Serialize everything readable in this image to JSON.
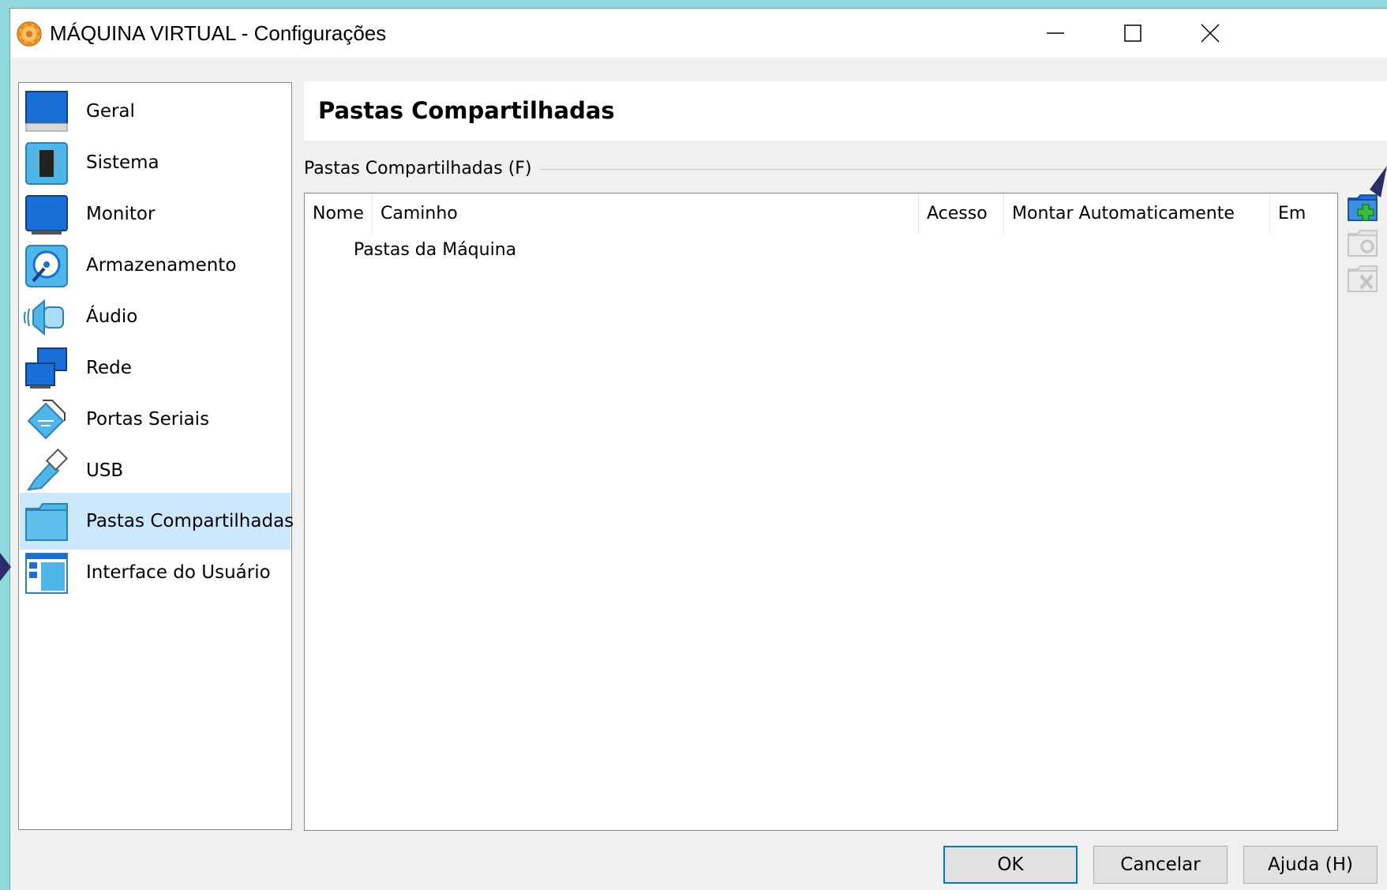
{
  "window": {
    "title": "MÁQUINA VIRTUAL - Configurações",
    "icon": "virtualbox-gear-icon"
  },
  "sidebar": {
    "selected_index": 8,
    "items": [
      {
        "label": "Geral",
        "icon": "general-monitor-icon"
      },
      {
        "label": "Sistema",
        "icon": "chip-icon"
      },
      {
        "label": "Monitor",
        "icon": "display-icon"
      },
      {
        "label": "Armazenamento",
        "icon": "storage-disk-icon"
      },
      {
        "label": "Áudio",
        "icon": "speaker-icon"
      },
      {
        "label": "Rede",
        "icon": "network-icon"
      },
      {
        "label": "Portas Seriais",
        "icon": "serial-port-icon"
      },
      {
        "label": "USB",
        "icon": "usb-icon"
      },
      {
        "label": "Pastas Compartilhadas",
        "icon": "folder-icon"
      },
      {
        "label": "Interface do Usuário",
        "icon": "user-interface-icon"
      }
    ]
  },
  "main": {
    "title": "Pastas Compartilhadas",
    "group_label": "Pastas Compartilhadas (F)",
    "table": {
      "columns": [
        "Nome",
        "Caminho",
        "Acesso",
        "Montar Automaticamente",
        "Em"
      ],
      "rows": [
        {
          "label": "Pastas da Máquina"
        }
      ]
    }
  },
  "buttons": {
    "ok": "OK",
    "cancel": "Cancelar",
    "help": "Ajuda (H)"
  },
  "colors": {
    "selected": "#cce8ff",
    "accent": "#0078d7",
    "background": "#8fd9de"
  }
}
